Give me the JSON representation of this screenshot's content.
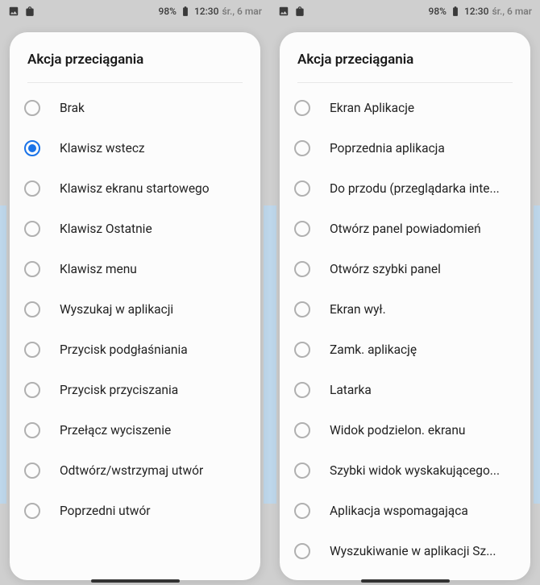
{
  "statusbar": {
    "battery_pct": "98%",
    "time": "12:30",
    "date": "śr., 6 mar"
  },
  "panels": [
    {
      "title": "Akcja przeciągania",
      "items": [
        {
          "label": "Brak",
          "selected": false
        },
        {
          "label": "Klawisz wstecz",
          "selected": true
        },
        {
          "label": "Klawisz ekranu startowego",
          "selected": false
        },
        {
          "label": "Klawisz Ostatnie",
          "selected": false
        },
        {
          "label": "Klawisz menu",
          "selected": false
        },
        {
          "label": "Wyszukaj w aplikacji",
          "selected": false
        },
        {
          "label": "Przycisk podgłaśniania",
          "selected": false
        },
        {
          "label": "Przycisk przyciszania",
          "selected": false
        },
        {
          "label": "Przełącz wyciszenie",
          "selected": false
        },
        {
          "label": "Odtwórz/wstrzymaj utwór",
          "selected": false
        },
        {
          "label": "Poprzedni utwór",
          "selected": false
        }
      ]
    },
    {
      "title": "Akcja przeciągania",
      "items": [
        {
          "label": "Ekran Aplikacje",
          "selected": false
        },
        {
          "label": "Poprzednia aplikacja",
          "selected": false
        },
        {
          "label": "Do przodu (przeglądarka inte...",
          "selected": false
        },
        {
          "label": "Otwórz panel powiadomień",
          "selected": false
        },
        {
          "label": "Otwórz szybki panel",
          "selected": false
        },
        {
          "label": "Ekran wył.",
          "selected": false
        },
        {
          "label": "Zamk. aplikację",
          "selected": false
        },
        {
          "label": "Latarka",
          "selected": false
        },
        {
          "label": "Widok podzielon. ekranu",
          "selected": false
        },
        {
          "label": "Szybki widok wyskakującego...",
          "selected": false
        },
        {
          "label": "Aplikacja wspomagająca",
          "selected": false
        },
        {
          "label": "Wyszukiwanie w aplikacji Sz...",
          "selected": false
        }
      ]
    }
  ]
}
